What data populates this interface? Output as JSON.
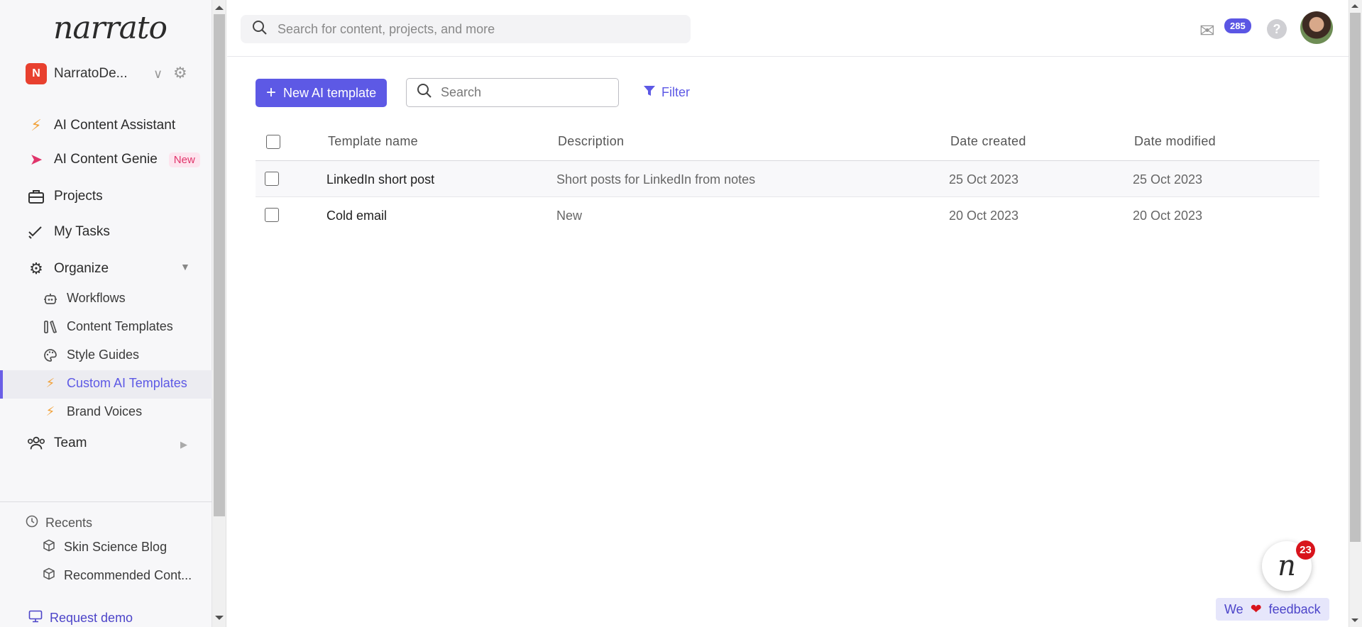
{
  "app": {
    "logo": "narrato"
  },
  "workspace": {
    "initial": "N",
    "name": "NarratoDe..."
  },
  "sidebar": {
    "items": [
      {
        "label": "AI Content Assistant"
      },
      {
        "label": "AI Content Genie",
        "badge": "New"
      },
      {
        "label": "Projects"
      },
      {
        "label": "My Tasks"
      },
      {
        "label": "Organize"
      },
      {
        "label": "Team"
      }
    ],
    "organize_children": [
      {
        "label": "Workflows"
      },
      {
        "label": "Content Templates"
      },
      {
        "label": "Style Guides"
      },
      {
        "label": "Custom AI Templates",
        "active": true
      },
      {
        "label": "Brand Voices"
      }
    ],
    "recents": {
      "title": "Recents",
      "items": [
        {
          "label": "Skin Science Blog"
        },
        {
          "label": "Recommended Cont..."
        }
      ]
    },
    "request_demo": "Request demo"
  },
  "topbar": {
    "search_placeholder": "Search for content, projects, and more",
    "mail_count": "285",
    "help": "?"
  },
  "toolbar": {
    "new_button": "New AI template",
    "search_placeholder": "Search",
    "filter_label": "Filter"
  },
  "table": {
    "columns": [
      "Template name",
      "Description",
      "Date created",
      "Date modified"
    ],
    "rows": [
      {
        "name": "LinkedIn short post",
        "description": "Short posts for LinkedIn from notes",
        "created": "25 Oct 2023",
        "modified": "25 Oct 2023"
      },
      {
        "name": "Cold email",
        "description": "New",
        "created": "20 Oct 2023",
        "modified": "20 Oct 2023"
      }
    ]
  },
  "widgets": {
    "chat_letter": "n",
    "chat_badge": "23",
    "feedback_we": "We",
    "feedback_text": "feedback"
  },
  "colors": {
    "accent": "#5d59e5",
    "new_badge": "#e0356b",
    "bolt": "#f2a23a",
    "workspace_avatar": "#e8402f"
  }
}
